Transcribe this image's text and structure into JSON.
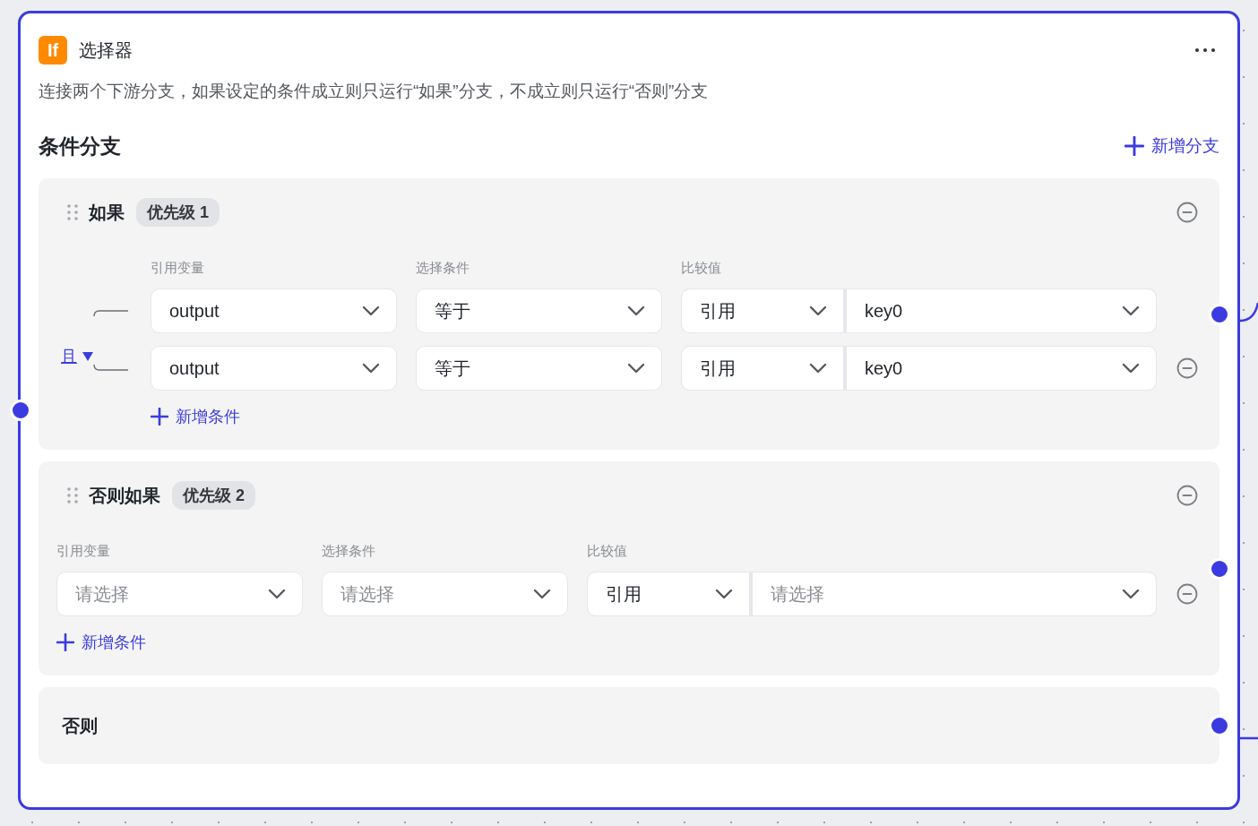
{
  "node": {
    "icon_text": "If",
    "title": "选择器",
    "description": "连接两个下游分支，如果设定的条件成立则只运行“如果”分支，不成立则只运行“否则”分支",
    "section_title": "条件分支",
    "add_branch": "新增分支",
    "branches": [
      {
        "kind": "condition",
        "name": "如果",
        "priority": "优先级 1",
        "logic": "且",
        "headers": [
          "引用变量",
          "选择条件",
          "比较值"
        ],
        "add_condition": "新增条件",
        "conditions": [
          {
            "variable": {
              "value": "output"
            },
            "operator": {
              "value": "等于"
            },
            "compare_type": {
              "value": "引用"
            },
            "compare_value": {
              "value": "key0"
            },
            "removable": false
          },
          {
            "variable": {
              "value": "output"
            },
            "operator": {
              "value": "等于"
            },
            "compare_type": {
              "value": "引用"
            },
            "compare_value": {
              "value": "key0"
            },
            "removable": true
          }
        ]
      },
      {
        "kind": "condition",
        "name": "否则如果",
        "priority": "优先级 2",
        "headers": [
          "引用变量",
          "选择条件",
          "比较值"
        ],
        "add_condition": "新增条件",
        "conditions": [
          {
            "variable": {
              "placeholder": "请选择"
            },
            "operator": {
              "placeholder": "请选择"
            },
            "compare_type": {
              "value": "引用"
            },
            "compare_value": {
              "placeholder": "请选择"
            },
            "removable": true
          }
        ]
      },
      {
        "kind": "else",
        "name": "否则"
      }
    ]
  }
}
